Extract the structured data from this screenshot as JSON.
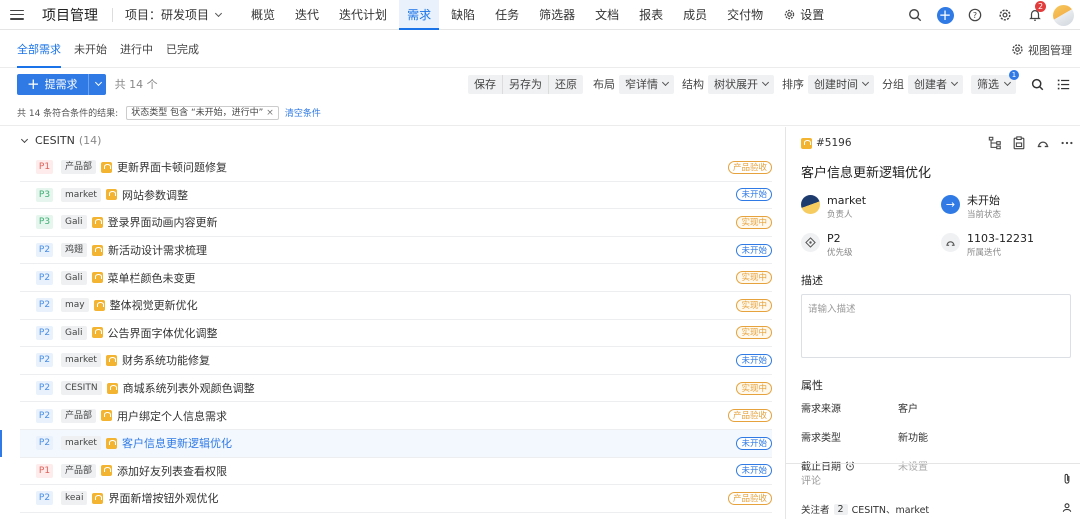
{
  "topnav": {
    "app_title": "项目管理",
    "project_label": "项目：研发项目",
    "items": [
      "概览",
      "迭代",
      "迭代计划",
      "需求",
      "缺陷",
      "任务",
      "筛选器",
      "文档",
      "报表",
      "成员",
      "交付物"
    ],
    "settings_label": "设置",
    "notification_count": "2"
  },
  "subtabs": {
    "items": [
      "全部需求",
      "未开始",
      "进行中",
      "已完成"
    ],
    "view_mgmt": "视图管理"
  },
  "toolbar": {
    "add_label": "提需求",
    "count_text": "共 14 个",
    "save": "保存",
    "save_as": "另存为",
    "restore": "还原",
    "layout_label": "布局",
    "layout_value": "窄详情",
    "structure_label": "结构",
    "structure_value": "树状展开",
    "sort_label": "排序",
    "sort_value": "创建时间",
    "group_label": "分组",
    "group_value": "创建者",
    "filter_label": "筛选",
    "filter_badge": "1"
  },
  "filter_line": {
    "result_text": "共 14 条符合条件的结果:",
    "condition": "状态类型 包含 “未开始，进行中”",
    "clear": "清空条件"
  },
  "group": {
    "name": "CESITN",
    "count": "(14)"
  },
  "rows": [
    {
      "prio": "P1",
      "tag": "产品部",
      "title": "更新界面卡顿问题修复",
      "status": "产品验收",
      "st": "accept"
    },
    {
      "prio": "P3",
      "tag": "market",
      "title": "网站参数调整",
      "status": "未开始",
      "st": "new"
    },
    {
      "prio": "P3",
      "tag": "Gali",
      "title": "登录界面动画内容更新",
      "status": "实现中",
      "st": "doing"
    },
    {
      "prio": "P2",
      "tag": "鸡翅",
      "title": "新活动设计需求梳理",
      "status": "未开始",
      "st": "new"
    },
    {
      "prio": "P2",
      "tag": "Gali",
      "title": "菜单栏颜色未变更",
      "status": "实现中",
      "st": "doing"
    },
    {
      "prio": "P2",
      "tag": "may",
      "title": "整体视觉更新优化",
      "status": "实现中",
      "st": "doing"
    },
    {
      "prio": "P2",
      "tag": "Gali",
      "title": "公告界面字体优化调整",
      "status": "实现中",
      "st": "doing"
    },
    {
      "prio": "P2",
      "tag": "market",
      "title": "财务系统功能修复",
      "status": "未开始",
      "st": "new"
    },
    {
      "prio": "P2",
      "tag": "CESITN",
      "title": "商城系统列表外观颜色调整",
      "status": "实现中",
      "st": "doing"
    },
    {
      "prio": "P2",
      "tag": "产品部",
      "title": "用户绑定个人信息需求",
      "status": "产品验收",
      "st": "accept"
    },
    {
      "prio": "P2",
      "tag": "market",
      "title": "客户信息更新逻辑优化",
      "status": "未开始",
      "st": "new",
      "selected": true
    },
    {
      "prio": "P1",
      "tag": "产品部",
      "title": "添加好友列表查看权限",
      "status": "未开始",
      "st": "new"
    },
    {
      "prio": "P2",
      "tag": "keai",
      "title": "界面新增按钮外观优化",
      "status": "产品验收",
      "st": "accept"
    }
  ],
  "detail": {
    "id": "#5196",
    "title": "客户信息更新逻辑优化",
    "owner_value": "market",
    "owner_label": "负责人",
    "status_value": "未开始",
    "status_label": "当前状态",
    "priority_value": "P2",
    "priority_label": "优先级",
    "iteration_value": "1103-12231",
    "iteration_label": "所属迭代",
    "desc_title": "描述",
    "desc_placeholder": "请输入描述",
    "attr_title": "属性",
    "attrs": [
      {
        "k": "需求来源",
        "v": "客户"
      },
      {
        "k": "需求类型",
        "v": "新功能"
      },
      {
        "k": "截止日期",
        "v": "未设置"
      }
    ],
    "comment_placeholder": "评论",
    "watchers_label": "关注者",
    "watchers_count": "2",
    "watchers_names": "CESITN、market"
  },
  "colors": {
    "accent": "#2f7ae5",
    "doing": "#e6a23c",
    "p1": "#e0625b",
    "p3": "#3fae74"
  }
}
